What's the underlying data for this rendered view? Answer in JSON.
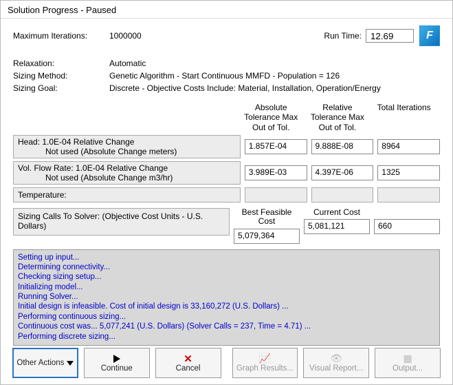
{
  "title": "Solution Progress - Paused",
  "header": {
    "max_iter_label": "Maximum Iterations:",
    "max_iter_value": "1000000",
    "runtime_label": "Run Time:",
    "runtime_value": "12.69",
    "logo_text": "F"
  },
  "info": {
    "relaxation_label": "Relaxation:",
    "relaxation_value": "Automatic",
    "sizing_method_label": "Sizing Method:",
    "sizing_method_value": "Genetic Algorithm - Start Continuous MMFD - Population = 126",
    "sizing_goal_label": "Sizing Goal:",
    "sizing_goal_value": "Discrete - Objective Costs Include: Material, Installation, Operation/Energy"
  },
  "tol_headers": {
    "abs": "Absolute Tolerance Max Out of Tol.",
    "rel": "Relative Tolerance Max Out of Tol.",
    "iter": "Total Iterations"
  },
  "metrics": [
    {
      "label_main": "Head: 1.0E-04 Relative Change",
      "label_sub": "Not used (Absolute Change meters)",
      "abs": "1.857E-04",
      "rel": "9.888E-08",
      "iter": "8964"
    },
    {
      "label_main": "Vol. Flow Rate: 1.0E-04 Relative Change",
      "label_sub": "Not used (Absolute Change m3/hr)",
      "abs": "3.989E-03",
      "rel": "4.397E-06",
      "iter": "1325"
    }
  ],
  "temperature_label": "Temperature:",
  "sizing": {
    "label": "Sizing Calls To Solver: (Objective Cost Units - U.S. Dollars)",
    "best_head": "Best Feasible Cost",
    "current_head": "Current Cost",
    "best_val": "5,079,364",
    "current_val": "5,081,121",
    "iter_val": "660"
  },
  "log": [
    "Setting up input...",
    "Determining connectivity...",
    "Checking sizing setup...",
    "Initializing model...",
    "Running Solver...",
    "Initial design is infeasible. Cost of initial design is 33,160,272 (U.S. Dollars) ...",
    "Performing continuous sizing...",
    "Continuous cost was... 5,077,241 (U.S. Dollars)  (Solver Calls = 237, Time = 4.71) ...",
    "Performing discrete sizing..."
  ],
  "buttons": {
    "other": "Other Actions",
    "continue": "Continue",
    "cancel": "Cancel",
    "graph": "Graph Results...",
    "visual": "Visual Report...",
    "output": "Output..."
  }
}
